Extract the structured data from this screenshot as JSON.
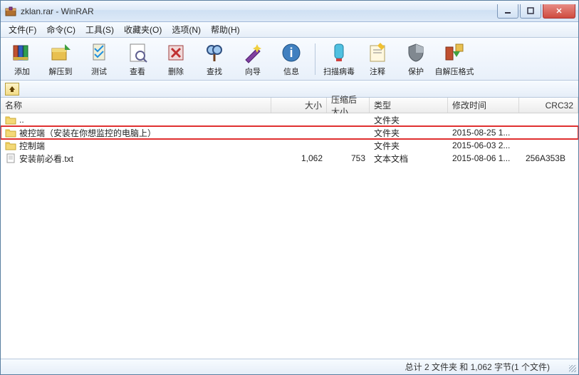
{
  "title": "zklan.rar - WinRAR",
  "menu": [
    "文件(F)",
    "命令(C)",
    "工具(S)",
    "收藏夹(O)",
    "选项(N)",
    "帮助(H)"
  ],
  "toolbar": {
    "add": "添加",
    "extract": "解压到",
    "test": "测试",
    "view": "查看",
    "delete": "删除",
    "find": "查找",
    "wizard": "向导",
    "info": "信息",
    "virus": "扫描病毒",
    "comment": "注释",
    "protect": "保护",
    "sfx": "自解压格式"
  },
  "columns": {
    "name": "名称",
    "size": "大小",
    "packed": "压缩后大小",
    "type": "类型",
    "date": "修改时间",
    "crc": "CRC32"
  },
  "rows": [
    {
      "icon": "folder",
      "name": "..",
      "size": "",
      "packed": "",
      "type": "文件夹",
      "date": "",
      "crc": "",
      "hl": false
    },
    {
      "icon": "folder",
      "name": "被控端（安装在你想监控的电脑上）",
      "size": "",
      "packed": "",
      "type": "文件夹",
      "date": "2015-08-25 1...",
      "crc": "",
      "hl": true
    },
    {
      "icon": "folder",
      "name": "控制端",
      "size": "",
      "packed": "",
      "type": "文件夹",
      "date": "2015-06-03 2...",
      "crc": "",
      "hl": false
    },
    {
      "icon": "file",
      "name": "安装前必看.txt",
      "size": "1,062",
      "packed": "753",
      "type": "文本文档",
      "date": "2015-08-06 1...",
      "crc": "256A353B",
      "hl": false
    }
  ],
  "status": "总计 2 文件夹 和 1,062 字节(1 个文件)"
}
